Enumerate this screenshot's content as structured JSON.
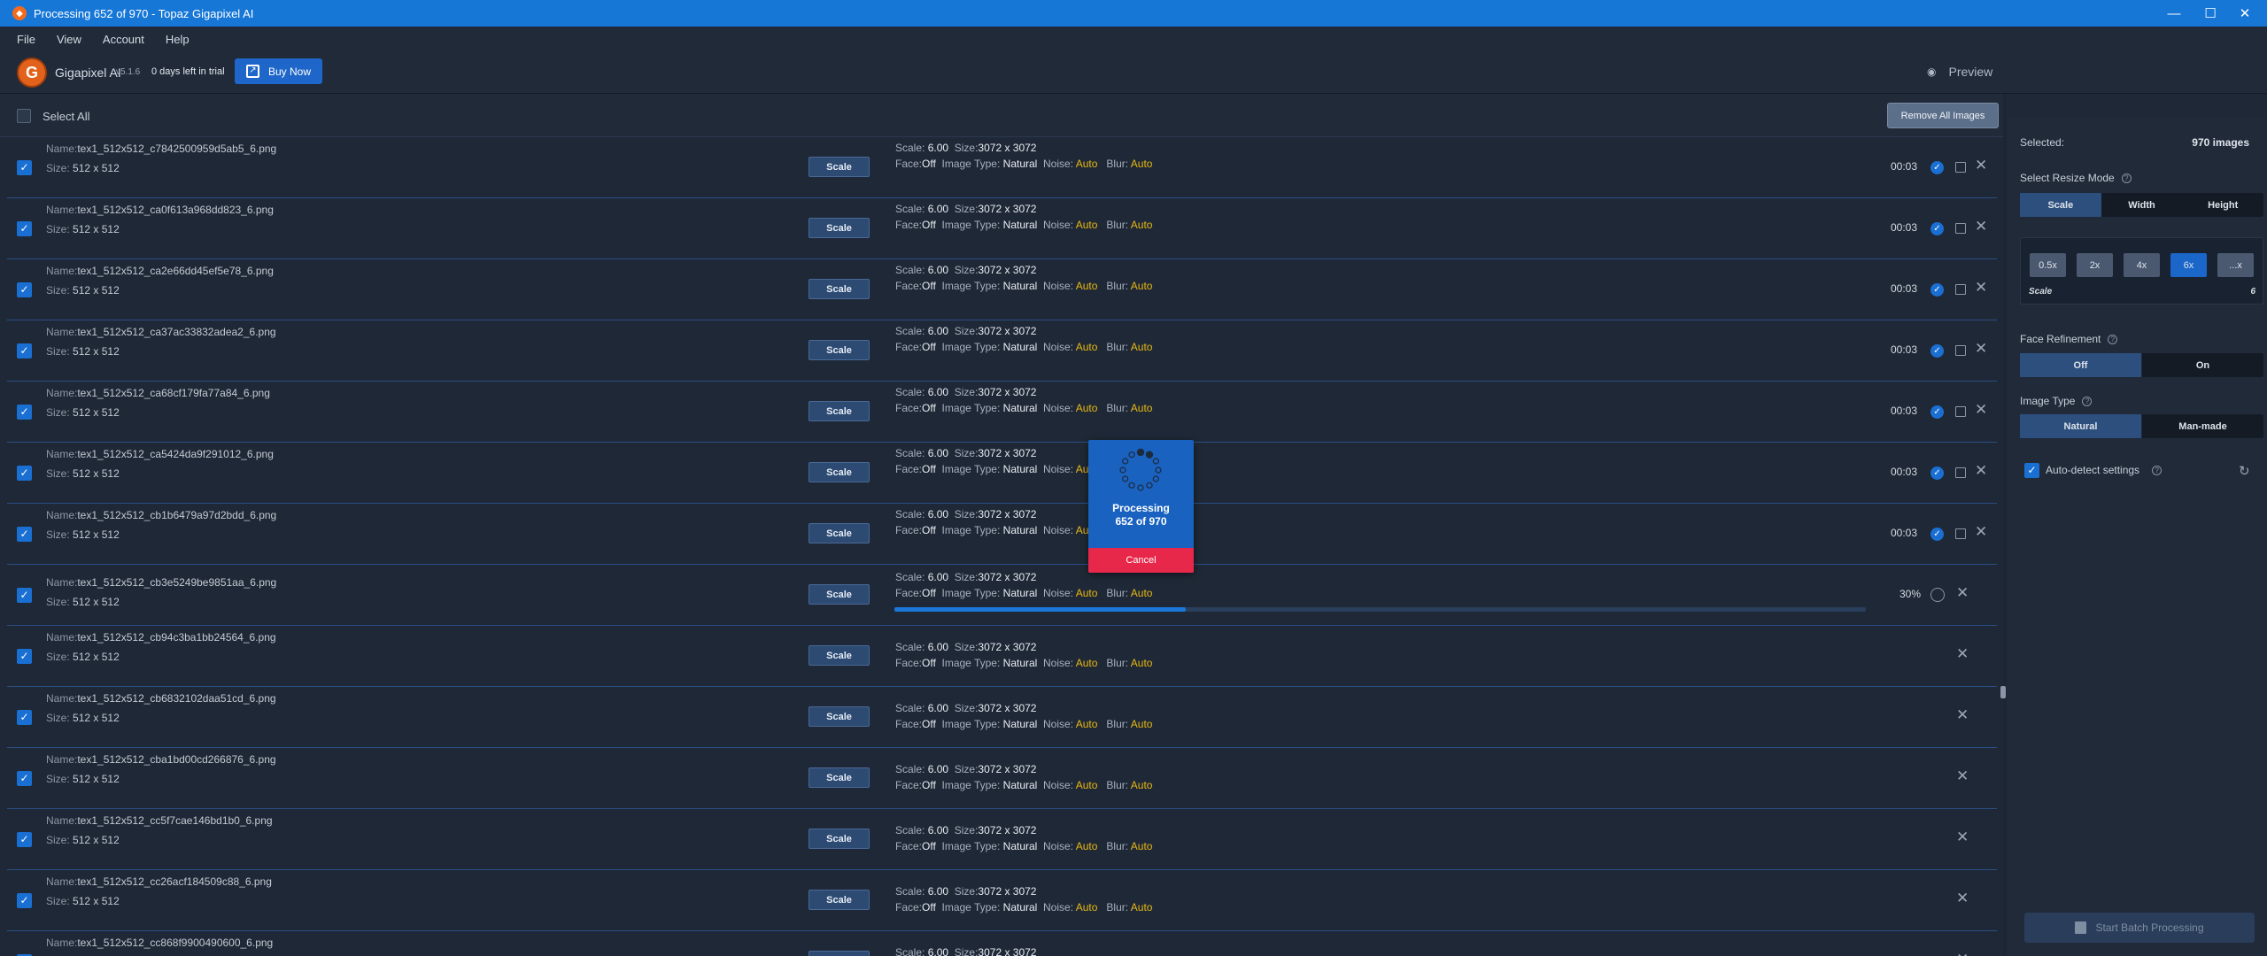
{
  "window": {
    "title": "Processing 652 of 970 - Topaz Gigapixel AI",
    "controls": {
      "minimize": "—",
      "maximize": "☐",
      "close": "✕"
    }
  },
  "menu": [
    "File",
    "View",
    "Account",
    "Help"
  ],
  "header": {
    "logo_letter": "G",
    "app_name": "Gigapixel AI",
    "version": "v5.1.6",
    "trial": "0 days left in trial",
    "buy_now": "Buy Now",
    "preview": "Preview"
  },
  "list": {
    "select_all": "Select All",
    "remove_all": "Remove All Images",
    "name_key": "Name:",
    "size_key": "Size:",
    "scale_key": "Scale:",
    "size2_key": "Size:",
    "face_key": "Face:",
    "type_key": "Image Type:",
    "noise_key": "Noise:",
    "blur_key": "Blur:",
    "rows": [
      {
        "name": "tex1_512x512_c7842500959d5ab5_6.png",
        "size": "512 x 512",
        "scale_btn": "Scale",
        "scale": "6.00",
        "out_size": "3072 x 3072",
        "face": "Off",
        "type": "Natural",
        "noise": "Auto",
        "blur": "Auto",
        "status": "done",
        "time": "00:03"
      },
      {
        "name": "tex1_512x512_ca0f613a968dd823_6.png",
        "size": "512 x 512",
        "scale_btn": "Scale",
        "scale": "6.00",
        "out_size": "3072 x 3072",
        "face": "Off",
        "type": "Natural",
        "noise": "Auto",
        "blur": "Auto",
        "status": "done",
        "time": "00:03"
      },
      {
        "name": "tex1_512x512_ca2e66dd45ef5e78_6.png",
        "size": "512 x 512",
        "scale_btn": "Scale",
        "scale": "6.00",
        "out_size": "3072 x 3072",
        "face": "Off",
        "type": "Natural",
        "noise": "Auto",
        "blur": "Auto",
        "status": "done",
        "time": "00:03"
      },
      {
        "name": "tex1_512x512_ca37ac33832adea2_6.png",
        "size": "512 x 512",
        "scale_btn": "Scale",
        "scale": "6.00",
        "out_size": "3072 x 3072",
        "face": "Off",
        "type": "Natural",
        "noise": "Auto",
        "blur": "Auto",
        "status": "done",
        "time": "00:03"
      },
      {
        "name": "tex1_512x512_ca68cf179fa77a84_6.png",
        "size": "512 x 512",
        "scale_btn": "Scale",
        "scale": "6.00",
        "out_size": "3072 x 3072",
        "face": "Off",
        "type": "Natural",
        "noise": "Auto",
        "blur": "Auto",
        "status": "done",
        "time": "00:03"
      },
      {
        "name": "tex1_512x512_ca5424da9f291012_6.png",
        "size": "512 x 512",
        "scale_btn": "Scale",
        "scale": "6.00",
        "out_size": "3072 x 3072",
        "face": "Off",
        "type": "Natural",
        "noise": "Auto",
        "blur": "Auto",
        "status": "done",
        "time": "00:03"
      },
      {
        "name": "tex1_512x512_cb1b6479a97d2bdd_6.png",
        "size": "512 x 512",
        "scale_btn": "Scale",
        "scale": "6.00",
        "out_size": "3072 x 3072",
        "face": "Off",
        "type": "Natural",
        "noise": "Auto",
        "blur": "Auto",
        "status": "done",
        "time": "00:03"
      },
      {
        "name": "tex1_512x512_cb3e5249be9851aa_6.png",
        "size": "512 x 512",
        "scale_btn": "Scale",
        "scale": "6.00",
        "out_size": "3072 x 3072",
        "face": "Off",
        "type": "Natural",
        "noise": "Auto",
        "blur": "Auto",
        "status": "processing",
        "percent": "30%",
        "progress": 0.3
      },
      {
        "name": "tex1_512x512_cb94c3ba1bb24564_6.png",
        "size": "512 x 512",
        "scale_btn": "Scale",
        "scale": "6.00",
        "out_size": "3072 x 3072",
        "face": "Off",
        "type": "Natural",
        "noise": "Auto",
        "blur": "Auto",
        "status": "queued"
      },
      {
        "name": "tex1_512x512_cb6832102daa51cd_6.png",
        "size": "512 x 512",
        "scale_btn": "Scale",
        "scale": "6.00",
        "out_size": "3072 x 3072",
        "face": "Off",
        "type": "Natural",
        "noise": "Auto",
        "blur": "Auto",
        "status": "queued"
      },
      {
        "name": "tex1_512x512_cba1bd00cd266876_6.png",
        "size": "512 x 512",
        "scale_btn": "Scale",
        "scale": "6.00",
        "out_size": "3072 x 3072",
        "face": "Off",
        "type": "Natural",
        "noise": "Auto",
        "blur": "Auto",
        "status": "queued"
      },
      {
        "name": "tex1_512x512_cc5f7cae146bd1b0_6.png",
        "size": "512 x 512",
        "scale_btn": "Scale",
        "scale": "6.00",
        "out_size": "3072 x 3072",
        "face": "Off",
        "type": "Natural",
        "noise": "Auto",
        "blur": "Auto",
        "status": "queued"
      },
      {
        "name": "tex1_512x512_cc26acf184509c88_6.png",
        "size": "512 x 512",
        "scale_btn": "Scale",
        "scale": "6.00",
        "out_size": "3072 x 3072",
        "face": "Off",
        "type": "Natural",
        "noise": "Auto",
        "blur": "Auto",
        "status": "queued"
      },
      {
        "name": "tex1_512x512_cc868f9900490600_6.png",
        "size": "",
        "scale_btn": "Scale",
        "scale": "6.00",
        "out_size": "3072 x 3072",
        "face": "",
        "type": "",
        "noise": "",
        "blur": "",
        "status": "queued"
      }
    ]
  },
  "processing": {
    "line1": "Processing",
    "line2": "652 of 970",
    "cancel": "Cancel"
  },
  "panel": {
    "selected_label": "Selected:",
    "selected_value": "970 images",
    "resize_mode_label": "Select Resize Mode",
    "resize_modes": [
      "Scale",
      "Width",
      "Height"
    ],
    "resize_mode_active": 0,
    "scales": [
      "0.5x",
      "2x",
      "4x",
      "6x",
      "...x"
    ],
    "scale_active": 3,
    "scale_label": "Scale",
    "scale_value": "6",
    "face_label": "Face Refinement",
    "face_options": [
      "Off",
      "On"
    ],
    "face_active": 0,
    "image_type_label": "Image Type",
    "image_type_options": [
      "Natural",
      "Man-made"
    ],
    "image_type_active": 0,
    "auto_detect": "Auto-detect settings",
    "start_batch": "Start Batch Processing"
  },
  "colors": {
    "titlebar": "#1677d7",
    "accent": "#1a6fd3",
    "warning_value": "#e8b914",
    "cancel": "#e8284a",
    "background": "#1f2836"
  }
}
